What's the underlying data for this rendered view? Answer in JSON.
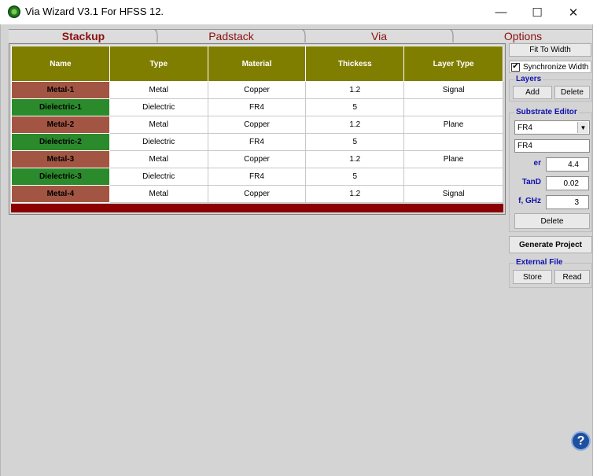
{
  "window": {
    "title": "Via Wizard V3.1 For HFSS 12.",
    "minimize": "—",
    "maximize": "☐",
    "close": "✕"
  },
  "tabs": [
    {
      "label": "Stackup",
      "active": true
    },
    {
      "label": "Padstack",
      "active": false
    },
    {
      "label": "Via",
      "active": false
    },
    {
      "label": "Options",
      "active": false
    }
  ],
  "grid": {
    "headers": [
      "Name",
      "Type",
      "Material",
      "Thickess",
      "Layer Type"
    ],
    "rows": [
      {
        "name": "Metal-1",
        "type": "Metal",
        "material": "Copper",
        "thickness": "1.2",
        "layer_type": "Signal"
      },
      {
        "name": "Dielectric-1",
        "type": "Dielectric",
        "material": "FR4",
        "thickness": "5",
        "layer_type": ""
      },
      {
        "name": "Metal-2",
        "type": "Metal",
        "material": "Copper",
        "thickness": "1.2",
        "layer_type": "Plane"
      },
      {
        "name": "Dielectric-2",
        "type": "Dielectric",
        "material": "FR4",
        "thickness": "5",
        "layer_type": ""
      },
      {
        "name": "Metal-3",
        "type": "Metal",
        "material": "Copper",
        "thickness": "1.2",
        "layer_type": "Plane"
      },
      {
        "name": "Dielectric-3",
        "type": "Dielectric",
        "material": "FR4",
        "thickness": "5",
        "layer_type": ""
      },
      {
        "name": "Metal-4",
        "type": "Metal",
        "material": "Copper",
        "thickness": "1.2",
        "layer_type": "Signal"
      }
    ],
    "colors": {
      "header": "#807e00",
      "metal": "#a35543",
      "dielectric": "#2b8a2b",
      "footer": "#8b0000"
    }
  },
  "panel": {
    "fit_to_width": "Fit To Width",
    "synchronize_width": "Synchronize Width",
    "synchronize_checked": true,
    "layers": {
      "title": "Layers",
      "add": "Add",
      "delete": "Delete"
    },
    "substrate": {
      "title": "Substrate Editor",
      "selected": "FR4",
      "name_value": "FR4",
      "er_label": "er",
      "er_value": "4.4",
      "tand_label": "TanD",
      "tand_value": "0.02",
      "f_label": "f, GHz",
      "f_value": "3",
      "delete": "Delete"
    },
    "generate_project": "Generate Project",
    "external_file": {
      "title": "External File",
      "store": "Store",
      "read": "Read"
    }
  },
  "help_icon": "?"
}
